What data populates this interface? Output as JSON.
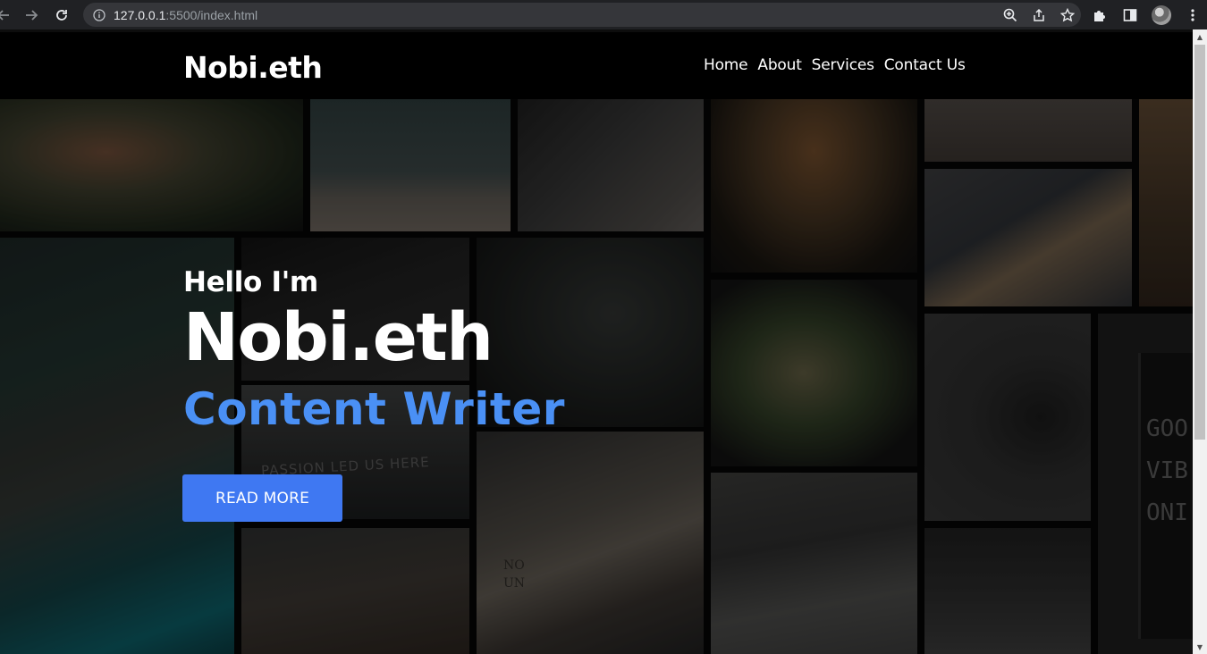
{
  "browser": {
    "url_host": "127.0.0.1",
    "url_rest": ":5500/index.html"
  },
  "site": {
    "logo": "Nobi.eth",
    "nav": [
      "Home",
      "About",
      "Services",
      "Contact Us"
    ]
  },
  "hero": {
    "greeting": "Hello I'm",
    "name": "Nobi.eth",
    "role": "Content Writer",
    "cta": "READ MORE"
  },
  "collage_text": {
    "sign_left": "PASSION LED US HERE",
    "sign_right": [
      "GOO",
      "VIB",
      "ONI"
    ],
    "shirt": [
      "NO",
      "UN"
    ]
  },
  "colors": {
    "accent_blue": "#4a90f5",
    "button_blue": "#3f78f2",
    "header_bg": "#000000",
    "chrome_bg": "#202124"
  },
  "icons": {
    "back": "arrow-left-icon",
    "forward": "arrow-right-icon",
    "reload": "reload-icon",
    "info": "info-icon",
    "zoom": "zoom-icon",
    "share": "share-icon",
    "bookmark": "star-icon",
    "extensions": "puzzle-icon",
    "side_panel": "side-panel-icon",
    "menu": "kebab-menu-icon"
  }
}
